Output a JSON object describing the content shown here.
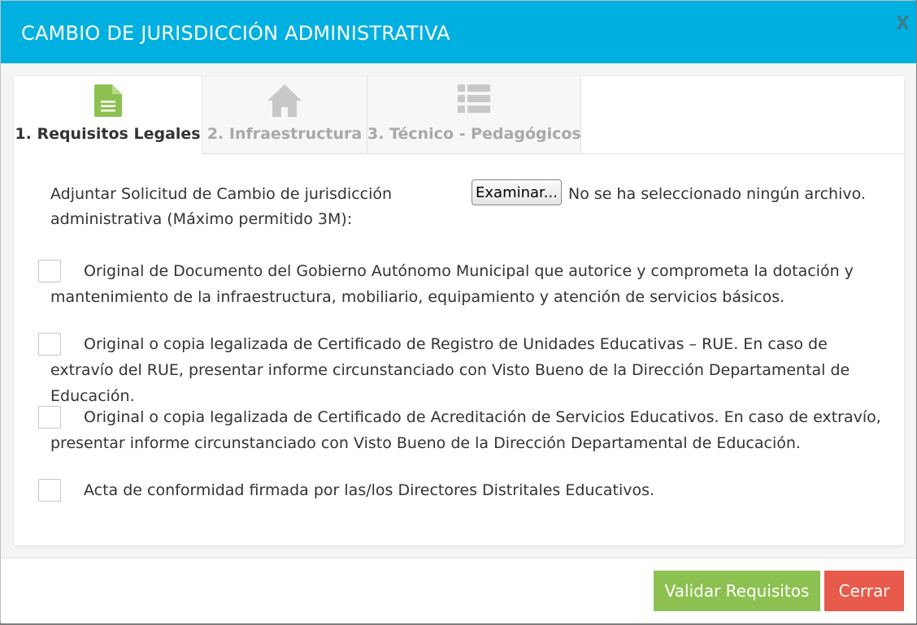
{
  "modal": {
    "title": "CAMBIO DE JURISDICCIÓN ADMINISTRATIVA",
    "close_label": "X"
  },
  "tabs": [
    {
      "label": "1. Requisitos Legales",
      "icon": "document-icon",
      "active": true,
      "icon_color": "#8cc151"
    },
    {
      "label": "2. Infraestructura",
      "icon": "home-icon",
      "active": false,
      "icon_color": "#c8c8c8"
    },
    {
      "label": "3. Técnico - Pedagógicos",
      "icon": "list-icon",
      "active": false,
      "icon_color": "#c8c8c8"
    }
  ],
  "file_upload": {
    "label": "Adjuntar Solicitud de Cambio de jurisdicción administrativa (Máximo permitido 3M):",
    "button_label": "Examinar...",
    "status": "No se ha seleccionado ningún archivo."
  },
  "requirements": [
    {
      "text": "Original de Documento del Gobierno Autónomo Municipal que autorice y comprometa la dotación y mantenimiento de la infraestructura, mobiliario, equipamiento y atención de servicios básicos.",
      "checked": false
    },
    {
      "text": "Original o copia legalizada de Certificado de Registro de Unidades Educativas – RUE. En caso de extravío del RUE, presentar informe circunstanciado con Visto Bueno de la Dirección Departamental de Educación.",
      "checked": false
    },
    {
      "text": "Original o copia legalizada de Certificado de Acreditación de Servicios Educativos. En caso de extravío, presentar informe circunstanciado con Visto Bueno de la Dirección Departamental de Educación.",
      "checked": false
    },
    {
      "text": "Acta de conformidad firmada por las/los Directores Distritales Educativos.",
      "checked": false
    }
  ],
  "footer": {
    "validate_label": "Validar Requisitos",
    "close_label": "Cerrar"
  },
  "colors": {
    "header": "#00b0e0",
    "validate": "#8cc151",
    "close": "#e85a49"
  }
}
